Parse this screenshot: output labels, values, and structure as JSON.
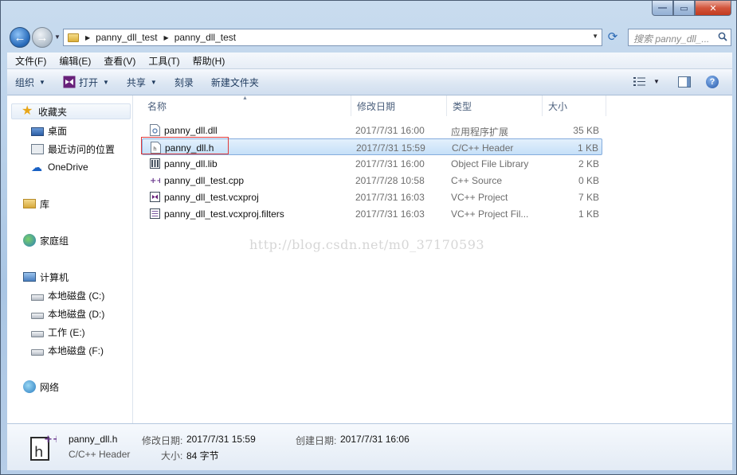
{
  "address": {
    "crumbs": [
      "panny_dll_test",
      "panny_dll_test"
    ]
  },
  "search": {
    "placeholder": "搜索 panny_dll_..."
  },
  "menu": [
    "文件(F)",
    "编辑(E)",
    "查看(V)",
    "工具(T)",
    "帮助(H)"
  ],
  "commands": {
    "organize": "组织",
    "open": "打开",
    "share": "共享",
    "burn": "刻录",
    "new_folder": "新建文件夹"
  },
  "sidebar": {
    "favorites": "收藏夹",
    "desktop": "桌面",
    "recent": "最近访问的位置",
    "onedrive": "OneDrive",
    "libraries": "库",
    "homegroup": "家庭组",
    "computer": "计算机",
    "drive_c": "本地磁盘 (C:)",
    "drive_d": "本地磁盘 (D:)",
    "drive_e": "工作 (E:)",
    "drive_f": "本地磁盘 (F:)",
    "network": "网络"
  },
  "columns": {
    "name": "名称",
    "date": "修改日期",
    "type": "类型",
    "size": "大小"
  },
  "files": [
    {
      "name": "panny_dll.dll",
      "date": "2017/7/31 16:00",
      "type": "应用程序扩展",
      "size": "35 KB",
      "icon": "dll-file-icon"
    },
    {
      "name": "panny_dll.h",
      "date": "2017/7/31 15:59",
      "type": "C/C++ Header",
      "size": "1 KB",
      "icon": "header-file-icon"
    },
    {
      "name": "panny_dll.lib",
      "date": "2017/7/31 16:00",
      "type": "Object File Library",
      "size": "2 KB",
      "icon": "lib-file-icon"
    },
    {
      "name": "panny_dll_test.cpp",
      "date": "2017/7/28 10:58",
      "type": "C++ Source",
      "size": "0 KB",
      "icon": "cpp-file-icon"
    },
    {
      "name": "panny_dll_test.vcxproj",
      "date": "2017/7/31 16:03",
      "type": "VC++ Project",
      "size": "7 KB",
      "icon": "vcxproj-file-icon"
    },
    {
      "name": "panny_dll_test.vcxproj.filters",
      "date": "2017/7/31 16:03",
      "type": "VC++ Project Fil...",
      "size": "1 KB",
      "icon": "filters-file-icon"
    }
  ],
  "watermark": "http://blog.csdn.net/m0_37170593",
  "details": {
    "name": "panny_dll.h",
    "type": "C/C++ Header",
    "modified_label": "修改日期:",
    "modified": "2017/7/31 15:59",
    "created_label": "创建日期:",
    "created": "2017/7/31 16:06",
    "size_label": "大小:",
    "size": "84 字节"
  },
  "colors": {
    "selection": "#c6e0f8",
    "highlight_box": "#e03a3a",
    "accent": "#2a6dbc"
  }
}
